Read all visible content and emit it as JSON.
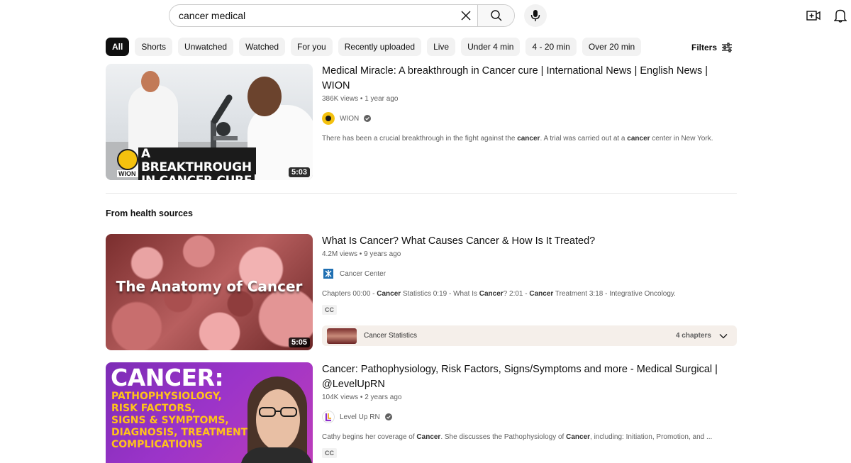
{
  "search": {
    "query": "cancer medical",
    "clear_icon": "close-icon",
    "search_icon": "search-icon",
    "mic_icon": "mic-icon"
  },
  "header_icons": {
    "create": "create-video-icon",
    "notifications": "bell-icon"
  },
  "chips": [
    {
      "label": "All",
      "active": true
    },
    {
      "label": "Shorts"
    },
    {
      "label": "Unwatched"
    },
    {
      "label": "Watched"
    },
    {
      "label": "For you"
    },
    {
      "label": "Recently uploaded"
    },
    {
      "label": "Live"
    },
    {
      "label": "Under 4 min"
    },
    {
      "label": "4 - 20 min"
    },
    {
      "label": "Over 20 min"
    }
  ],
  "filters": {
    "label": "Filters",
    "icon": "sliders-icon"
  },
  "results": [
    {
      "title": "Medical Miracle: A breakthrough in Cancer cure | International News | English News | WION",
      "views": "386K views",
      "age": "1 year ago",
      "channel": "WION",
      "verified": true,
      "duration": "5:03",
      "thumb_text_1": "A BREAKTHROUGH",
      "thumb_text_2": "IN CANCER CURE",
      "thumb_logo": "WION",
      "desc_parts": [
        "There has been a crucial breakthrough in the fight against the ",
        "cancer",
        ". A trial was carried out at a ",
        "cancer",
        " center in New York."
      ]
    }
  ],
  "section": {
    "title": "From health sources"
  },
  "health_results": [
    {
      "title": "What Is Cancer? What Causes Cancer & How Is It Treated?",
      "views": "4.2M views",
      "age": "9 years ago",
      "channel": "Cancer Center",
      "duration": "5:05",
      "thumb_text": "The Anatomy of Cancer",
      "desc_parts": [
        "Chapters 00:00 - ",
        "Cancer",
        " Statistics 0:19 - What Is ",
        "Cancer",
        "? 2:01 - ",
        "Cancer",
        " Treatment 3:18 - Integrative Oncology."
      ],
      "badge": "CC",
      "chapter_label": "Cancer Statistics",
      "chapter_count": "4 chapters"
    },
    {
      "title": "Cancer: Pathophysiology, Risk Factors, Signs/Symptoms and more - Medical Surgical | @LevelUpRN",
      "views": "104K views",
      "age": "2 years ago",
      "channel": "Level Up RN",
      "verified": true,
      "thumb_big": "CANCER:",
      "thumb_lines": [
        "PATHOPHYSIOLOGY,",
        "RISK FACTORS,",
        "SIGNS & SYMPTOMS,",
        "DIAGNOSIS, TREATMENT &",
        "COMPLICATIONS"
      ],
      "desc_parts": [
        "Cathy begins her coverage of ",
        "Cancer",
        ". She discusses the Pathophysiology of ",
        "Cancer",
        ", including: Initiation, Promotion, and ..."
      ],
      "badge": "CC"
    }
  ],
  "meta_separator": " • ",
  "colors": {
    "accent": "#0f0f0f",
    "chip_bg": "#f2f2f2",
    "meta": "#606060",
    "chapter_bg": "#f5efea"
  }
}
